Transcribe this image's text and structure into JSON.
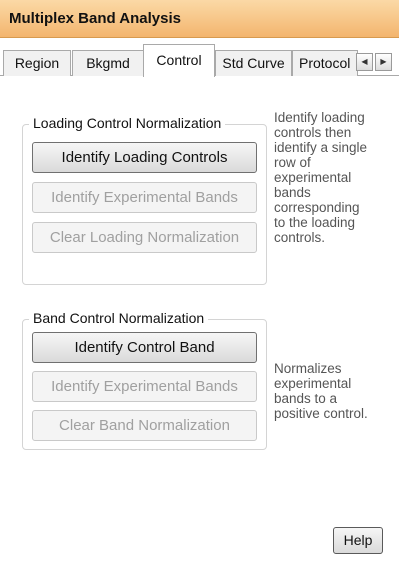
{
  "window": {
    "title": "Multiplex Band Analysis"
  },
  "tabs": [
    {
      "label": "Region"
    },
    {
      "label": "Bkgmd"
    },
    {
      "label": "Control"
    },
    {
      "label": "Std Curve"
    },
    {
      "label": "Protocol"
    }
  ],
  "active_tab": "Control",
  "tab_scroll": {
    "left_icon": "scroll-left-icon",
    "right_icon": "scroll-right-icon"
  },
  "loading_control": {
    "title": "Loading Control Normalization",
    "buttons": [
      {
        "label": "Identify Loading Controls",
        "enabled": true
      },
      {
        "label": "Identify Experimental Bands",
        "enabled": false
      },
      {
        "label": "Clear Loading Normalization",
        "enabled": false
      }
    ],
    "description_lines": [
      "Identify loading",
      "controls then",
      "identify a single",
      "row of",
      "experimental",
      "bands",
      "corresponding",
      "to the loading",
      "controls."
    ]
  },
  "band_control": {
    "title": "Band Control Normalization",
    "buttons": [
      {
        "label": "Identify Control Band",
        "enabled": true
      },
      {
        "label": "Identify Experimental Bands",
        "enabled": false
      },
      {
        "label": "Clear Band Normalization",
        "enabled": false
      }
    ],
    "description_lines": [
      "Normalizes",
      "experimental",
      "bands to a",
      "positive control."
    ]
  },
  "footer": {
    "help_label": "Help"
  }
}
